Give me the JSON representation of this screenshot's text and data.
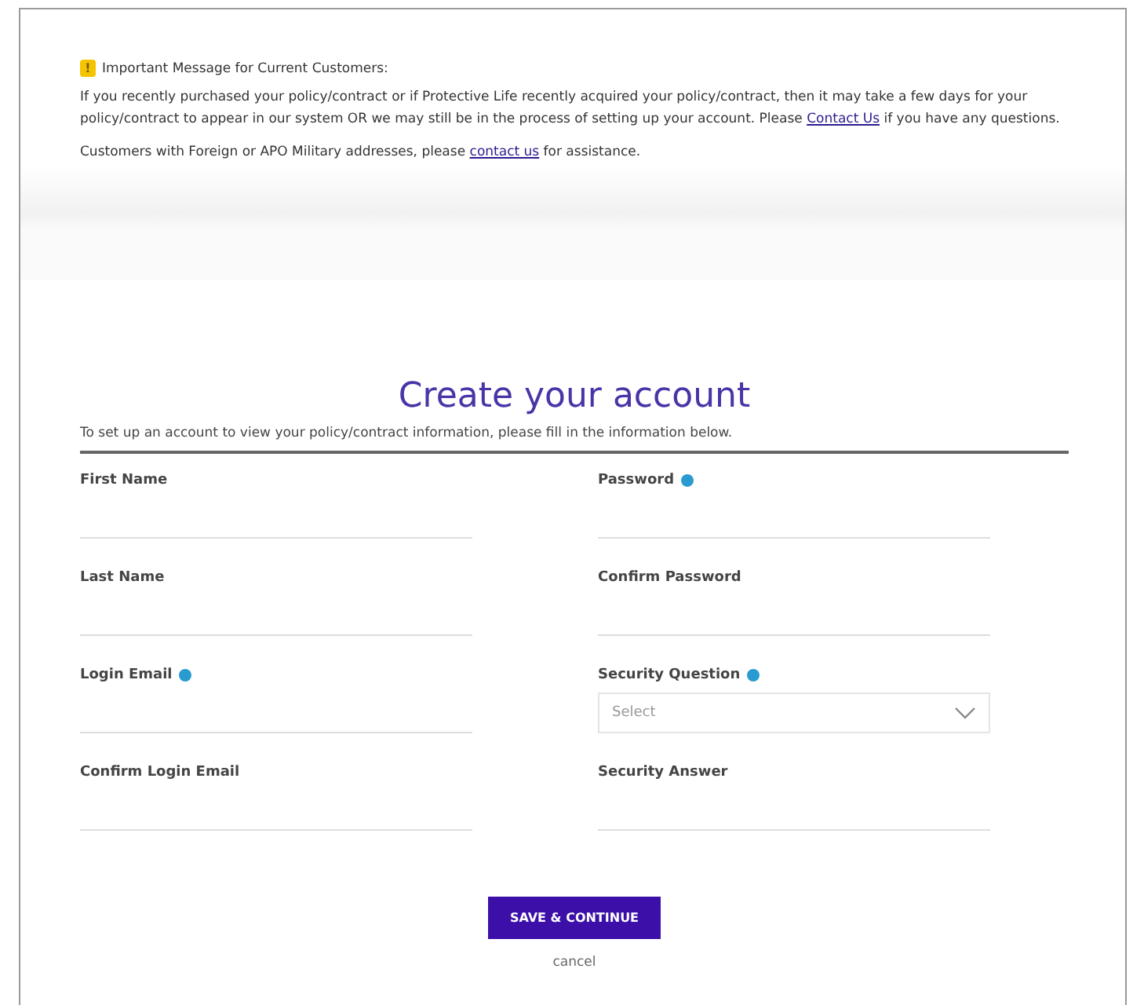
{
  "notice": {
    "icon": "!",
    "title": "Important Message for Current Customers:",
    "paragraphs": [
      {
        "before": "If you recently purchased your policy/contract or if Protective Life recently acquired your policy/contract, then it may take a few days for your policy/contract to appear in our system OR we may still be in the process of setting up your account. Please ",
        "link": "Contact Us",
        "after": " if you have any questions."
      },
      {
        "before": "Customers with Foreign or APO Military addresses, please ",
        "link": "contact us",
        "after": " for assistance."
      }
    ]
  },
  "form": {
    "title": "Create your account",
    "intro": "To set up an account to view your policy/contract information, please fill in the information below.",
    "fields": [
      {
        "label": "First Name",
        "kind": "text",
        "info": false
      },
      {
        "label": "Password",
        "kind": "text",
        "info": true
      },
      {
        "label": "Last Name",
        "kind": "text",
        "info": false
      },
      {
        "label": "Confirm Password",
        "kind": "text",
        "info": false
      },
      {
        "label": "Login Email",
        "kind": "text",
        "info": true
      },
      {
        "label": "Security Question",
        "kind": "select",
        "info": true,
        "placeholder": "Select"
      },
      {
        "label": "Confirm Login Email",
        "kind": "text",
        "info": false
      },
      {
        "label": "Security Answer",
        "kind": "text",
        "info": false
      }
    ],
    "submit": "SAVE & CONTINUE",
    "cancel": "cancel"
  }
}
